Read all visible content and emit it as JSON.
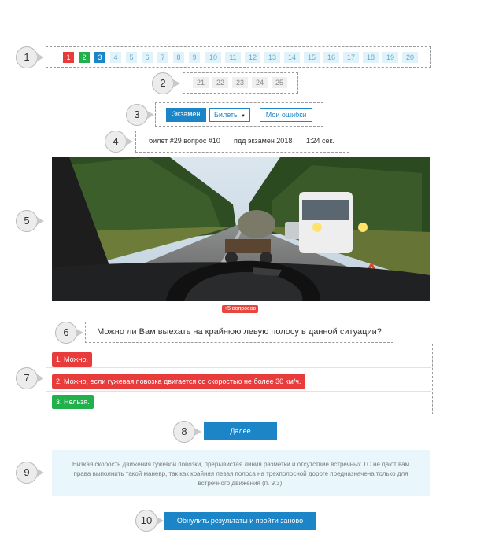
{
  "markers": [
    "1",
    "2",
    "3",
    "4",
    "5",
    "6",
    "7",
    "8",
    "9",
    "10"
  ],
  "questions_row1": [
    "1",
    "2",
    "3",
    "4",
    "5",
    "6",
    "7",
    "8",
    "9",
    "10",
    "11",
    "12",
    "13",
    "14",
    "15",
    "16",
    "17",
    "18",
    "19",
    "20"
  ],
  "questions_row2": [
    "21",
    "22",
    "23",
    "24",
    "25"
  ],
  "tabs": {
    "exam": "Экзамен",
    "tickets": "Билеты",
    "mistakes": "Мои ошибки"
  },
  "info": {
    "ticket": "билет #29 вопрос #10",
    "exam": "пдд экзамен 2018",
    "time": "1:24 сек."
  },
  "penalty_badge": "+5 вопросов",
  "question": "Можно ли Вам выехать на крайнюю левую полосу в данной ситуации?",
  "answers": [
    {
      "text": "1. Можно.",
      "color": "#e83c3c"
    },
    {
      "text": "2. Можно, если гужевая повозка двигается со скоростью не более 30 км/ч.",
      "color": "#e83c3c"
    },
    {
      "text": "3. Нельзя.",
      "color": "#21b04b"
    }
  ],
  "next_button": "Далее",
  "explanation": "Низкая скорость движения гужевой повозки, прерывистая линия разметки и отсутствие встречных ТС не дают вам права выполнить такой маневр, так как крайняя левая полоса на трехполосной дороге предназначена только для встречного движения (п. 9.3).",
  "reset_button": "Обнулить результаты и пройти заново",
  "colors": {
    "accent": "#1c85c8",
    "correct": "#21b04b",
    "wrong": "#e83c3c",
    "explain_bg": "#e9f6fc"
  }
}
